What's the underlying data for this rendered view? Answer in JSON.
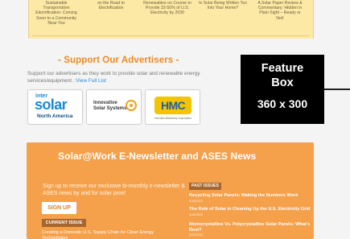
{
  "top_strip": {
    "items": [
      {
        "text": "Sustainable Transportation Electrification: Coming Soon to a Community Near You"
      },
      {
        "text": "on the Road to Electrification"
      },
      {
        "text": "Renewables on Course to Provide 33-50% of U.S. Electricity by 2030"
      },
      {
        "text": "Is Solar Being Written Too Into Your Home?"
      },
      {
        "text": "A Solar Paper Review & Commentary: Hidden in Plain Sight – Ready or Not!"
      }
    ]
  },
  "support": {
    "title": "- Support Our Advertisers -",
    "text": "Support our advertisers as they work to provide solar and renewable energy services/equipment.",
    "link": "View Full List",
    "logos": [
      {
        "top": "inter",
        "main": "solar",
        "bottom": "North America"
      },
      {
        "top": "Innovative",
        "bottom": "Solar Systems"
      },
      {
        "main": "HMC",
        "sub": "Hercules Machinery Corporation"
      }
    ]
  },
  "feature_box": {
    "line1": "Feature",
    "line2": "Box",
    "line3": "360 x 300"
  },
  "newsletter": {
    "title": "Solar@Work E-Newsletter and ASES News",
    "signup_text": "Sign up to receive our exclusive bi-monthly e-newsletter & ASES news by and for solar pros!",
    "signup_button": "SIGN UP",
    "current_badge": "CURRENT ISSUE",
    "current_article": "Creating a Domestic U.S. Supply Chain for Clean Energy Technologies",
    "past_badge": "PAST ISSUES",
    "past_issues": [
      {
        "title": "Recycling Solar Panels: Making the Numbers Work",
        "date": "5/18/2023"
      },
      {
        "title": "The Role of Solar in Cleaning Up the U.S. Electricity Grid",
        "date": "4/18/2023"
      },
      {
        "title": "Monocrystalline Vs. Polycrystalline Solar Panels: What's Best?",
        "date": "3/13/2023"
      }
    ]
  }
}
